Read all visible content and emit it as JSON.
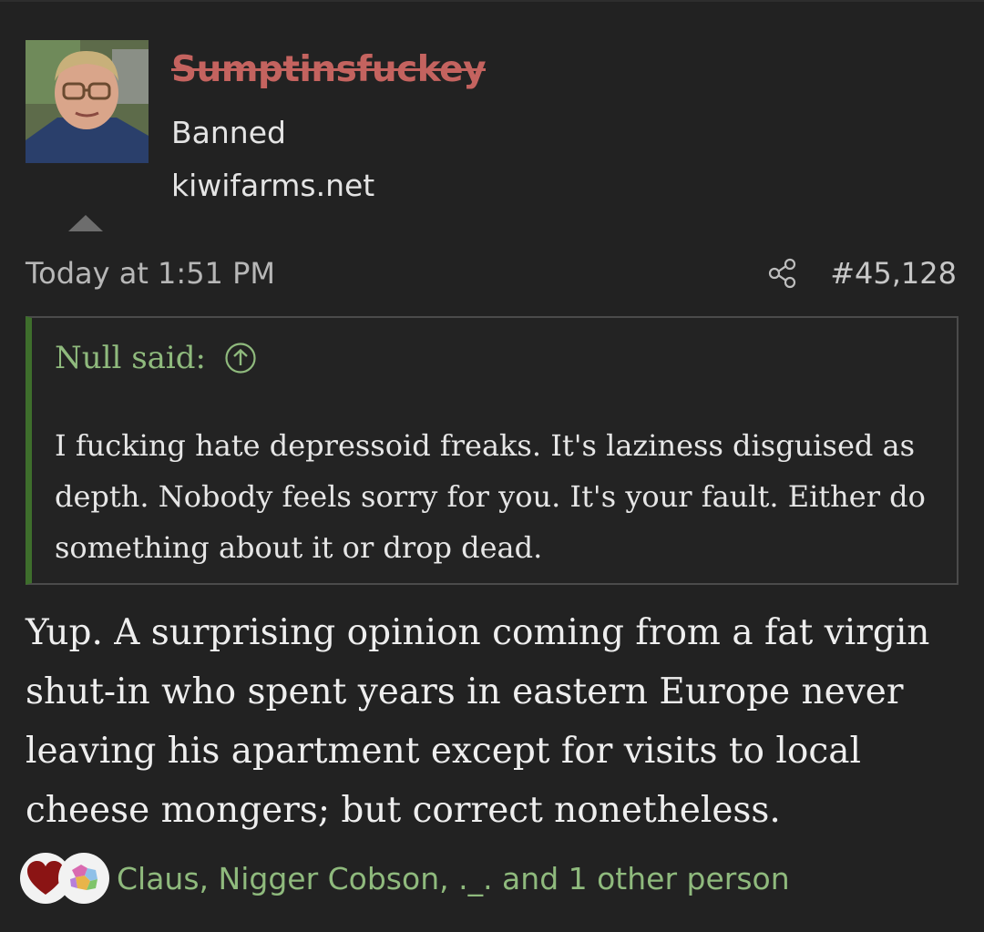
{
  "user": {
    "name": "Sumptinsfuckey",
    "title": "Banned",
    "location": "kiwifarms.net"
  },
  "post": {
    "date": "Today at 1:51 PM",
    "number": "#45,128"
  },
  "quote": {
    "author": "Null said:",
    "body": "I fucking hate depressoid freaks. It's laziness disguised as depth. Nobody feels sorry for you. It's your fault. Either do something about it or drop dead."
  },
  "message": {
    "body": "Yup. A surprising opinion coming from a fat virgin shut-in who spent years in eastern Europe never leaving his apartment except for visits to local cheese mongers; but correct nonetheless."
  },
  "reactions": {
    "icons": [
      "heart-icon",
      "puzzle-map-icon"
    ],
    "list_text": "Claus, Nigger Cobson, ._. and 1 other person"
  },
  "colors": {
    "background": "#222222",
    "username_banned": "#c4635f",
    "quote_accent": "#3e6e2c",
    "link_green": "#8fba7d"
  }
}
